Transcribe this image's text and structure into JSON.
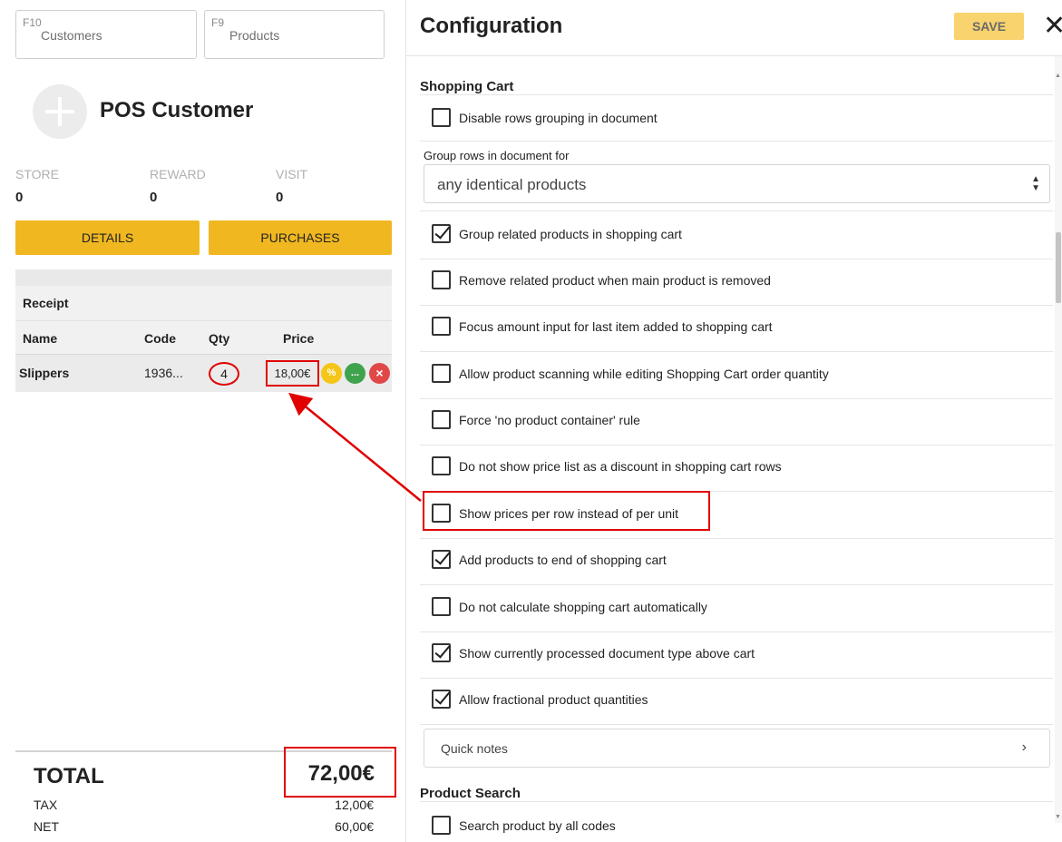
{
  "left": {
    "fkeys": [
      {
        "key": "F10",
        "label": "Customers"
      },
      {
        "key": "F9",
        "label": "Products"
      }
    ],
    "customer_name": "POS Customer",
    "stats": [
      {
        "label": "STORE",
        "value": "0"
      },
      {
        "label": "REWARD",
        "value": "0"
      },
      {
        "label": "VISIT",
        "value": "0"
      }
    ],
    "buttons": {
      "details": "DETAILS",
      "purchases": "PURCHASES"
    },
    "receipt": {
      "title": "Receipt",
      "columns": [
        "Name",
        "Code",
        "Qty",
        "Price"
      ],
      "rows": [
        {
          "name": "Slippers",
          "code": "1936...",
          "qty": "4",
          "price": "18,00€",
          "actions": [
            "%",
            "...",
            "×"
          ]
        }
      ]
    },
    "totals": {
      "total_label": "TOTAL",
      "total_value": "72,00€",
      "tax_label": "TAX",
      "tax_value": "12,00€",
      "net_label": "NET",
      "net_value": "60,00€"
    }
  },
  "config": {
    "title": "Configuration",
    "save_label": "SAVE",
    "close_symbol": "✕",
    "section_shopping_cart": "Shopping Cart",
    "opt_disable_grouping": {
      "label": "Disable rows grouping in document",
      "checked": false
    },
    "group_rows": {
      "label": "Group rows in document for",
      "value": "any identical products"
    },
    "options": [
      {
        "label": "Group related products in shopping cart",
        "checked": true
      },
      {
        "label": "Remove related product when main product is removed",
        "checked": false
      },
      {
        "label": "Focus amount input for last item added to shopping cart",
        "checked": false
      },
      {
        "label": "Allow product scanning while editing Shopping Cart order quantity",
        "checked": false
      },
      {
        "label": "Force 'no product container' rule",
        "checked": false
      },
      {
        "label": "Do not show price list as a discount in shopping cart rows",
        "checked": false
      },
      {
        "label": "Show prices per row instead of per unit",
        "checked": false
      },
      {
        "label": "Add products to end of shopping cart",
        "checked": true
      },
      {
        "label": "Do not calculate shopping cart automatically",
        "checked": false
      },
      {
        "label": "Show currently processed document type above cart",
        "checked": true
      },
      {
        "label": "Allow fractional product quantities",
        "checked": true
      }
    ],
    "quick_notes": "Quick notes",
    "section_product_search": "Product Search",
    "opt_search_all_codes": {
      "label": "Search product by all codes",
      "checked": false
    }
  },
  "colors": {
    "accent_yellow": "#f0b721",
    "save_yellow": "#f8d36e",
    "highlight_red": "#e00000",
    "discount_button": "#f5c518",
    "more_button": "#3fa34d",
    "remove_button": "#e04848"
  }
}
